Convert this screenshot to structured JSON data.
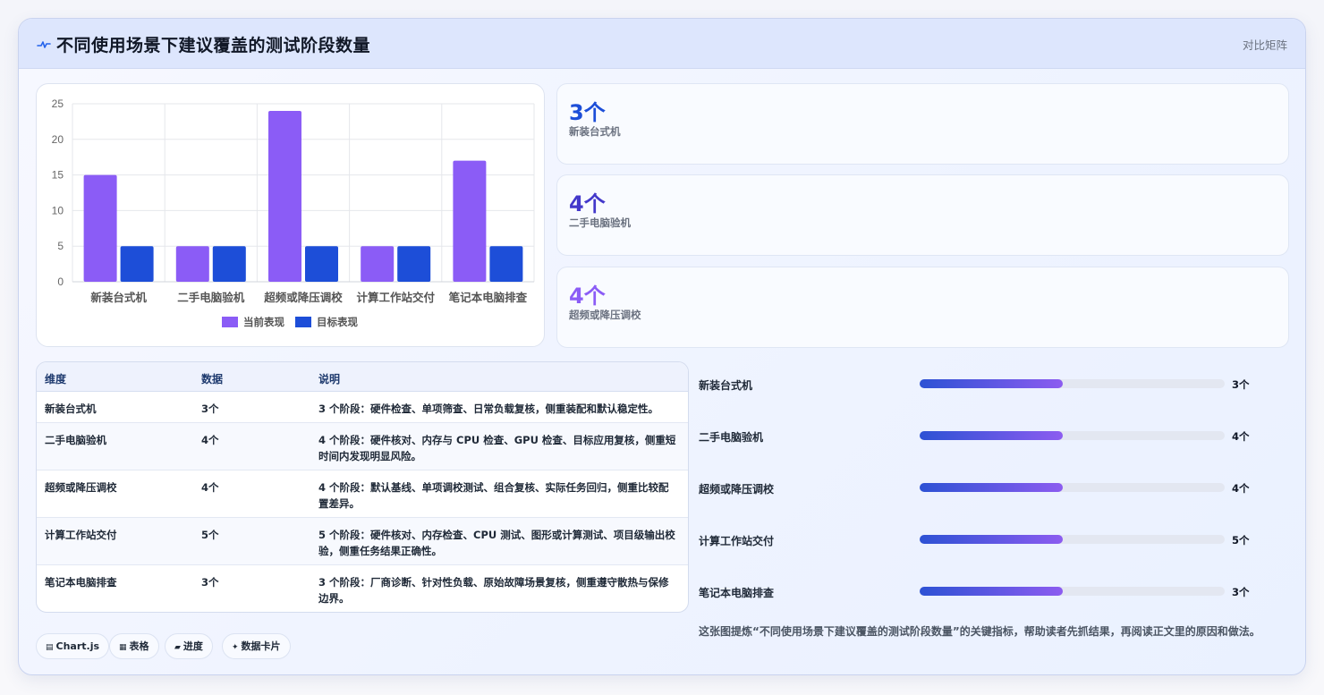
{
  "header": {
    "title": "不同使用场景下建议覆盖的测试阶段数量",
    "tag": "对比矩阵",
    "icon": "pulse-icon"
  },
  "chart_data": {
    "type": "bar",
    "categories": [
      "新装台式机",
      "二手电脑验机",
      "超频或降压调校",
      "计算工作站交付",
      "笔记本电脑排查"
    ],
    "series": [
      {
        "name": "当前表现",
        "values": [
          15,
          5,
          24,
          5,
          17
        ],
        "color": "#8b5cf6"
      },
      {
        "name": "目标表现",
        "values": [
          5,
          5,
          5,
          5,
          5
        ],
        "color": "#1d4ed8"
      }
    ],
    "ylim": [
      0,
      25
    ],
    "yticks": [
      "0",
      "5",
      "10",
      "15",
      "20",
      "25"
    ],
    "grid": true,
    "legend_position": "bottom"
  },
  "stats": [
    {
      "value": "3个",
      "label": "新装台式机",
      "color": "#1d4ed8"
    },
    {
      "value": "4个",
      "label": "二手电脑验机",
      "color": "#4338ca"
    },
    {
      "value": "4个",
      "label": "超频或降压调校",
      "color": "#8b5cf6"
    }
  ],
  "table": {
    "headers": [
      "维度",
      "数据",
      "说明"
    ],
    "rows": [
      {
        "dim": "新装台式机",
        "val": "3个",
        "desc": "3 个阶段：硬件检查、单项筛查、日常负载复核，侧重装配和默认稳定性。"
      },
      {
        "dim": "二手电脑验机",
        "val": "4个",
        "desc": "4 个阶段：硬件核对、内存与 CPU 检查、GPU 检查、目标应用复核，侧重短时间内发现明显风险。"
      },
      {
        "dim": "超频或降压调校",
        "val": "4个",
        "desc": "4 个阶段：默认基线、单项调校测试、组合复核、实际任务回归，侧重比较配置差异。"
      },
      {
        "dim": "计算工作站交付",
        "val": "5个",
        "desc": "5 个阶段：硬件核对、内存检查、CPU 测试、图形或计算测试、项目级输出校验，侧重任务结果正确性。"
      },
      {
        "dim": "笔记本电脑排查",
        "val": "3个",
        "desc": "3 个阶段：厂商诊断、针对性负载、原始故障场景复核，侧重遵守散热与保修边界。"
      }
    ]
  },
  "bars": [
    {
      "label": "新装台式机",
      "value": "3个",
      "fill": 0.47
    },
    {
      "label": "二手电脑验机",
      "value": "4个",
      "fill": 0.47
    },
    {
      "label": "超频或降压调校",
      "value": "4个",
      "fill": 0.47
    },
    {
      "label": "计算工作站交付",
      "value": "5个",
      "fill": 0.47
    },
    {
      "label": "笔记本电脑排查",
      "value": "3个",
      "fill": 0.47
    }
  ],
  "summary": "这张图提炼“不同使用场景下建议覆盖的测试阶段数量”的关键指标，帮助读者先抓结果，再阅读正文里的原因和做法。",
  "chips": [
    {
      "icon": "chart-icon",
      "label": "Chart.js"
    },
    {
      "icon": "table-icon",
      "label": "表格"
    },
    {
      "icon": "progress-icon",
      "label": "进度"
    },
    {
      "icon": "sparkle-icon",
      "label": "数据卡片"
    }
  ]
}
